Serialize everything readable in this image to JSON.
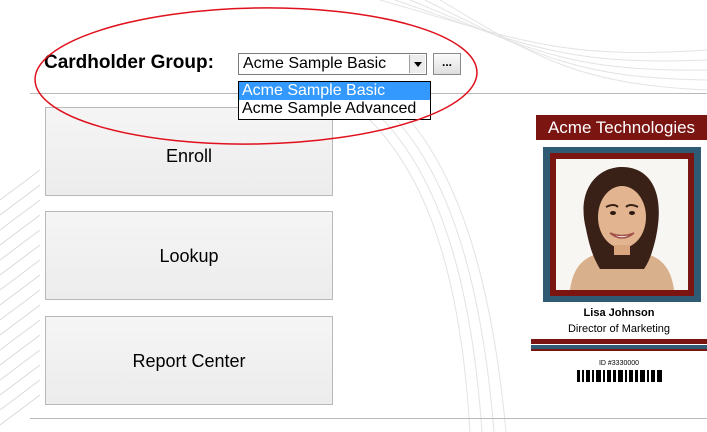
{
  "group_selector": {
    "label": "Cardholder Group:",
    "selected": "Acme Sample Basic",
    "browse_label": "...",
    "options": [
      "Acme Sample Basic",
      "Acme Sample Advanced"
    ]
  },
  "actions": {
    "enroll": "Enroll",
    "lookup": "Lookup",
    "report_center": "Report Center"
  },
  "id_card": {
    "company": "Acme Technologies",
    "name": "Lisa Johnson",
    "title": "Director of Marketing",
    "id_number": "ID #3330000"
  },
  "colors": {
    "highlight": "#e0101c",
    "card_red": "#7a1512",
    "card_blue": "#2f5b75",
    "dropdown_selected": "#3399ff"
  }
}
